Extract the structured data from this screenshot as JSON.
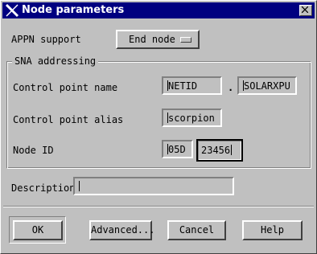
{
  "window": {
    "title": "Node parameters"
  },
  "appn": {
    "label": "APPN support",
    "value": "End node"
  },
  "sna": {
    "group_title": "SNA addressing",
    "cp_name_label": "Control point name",
    "netid": "NETID",
    "dot": ".",
    "cp_name": "SOLARXPU",
    "cp_alias_label": "Control point alias",
    "cp_alias": "scorpion",
    "node_id_label": "Node ID",
    "node_id_block": "05D",
    "node_id_num": "23456"
  },
  "description": {
    "label": "Description",
    "value": ""
  },
  "buttons": {
    "ok": "OK",
    "advanced": "Advanced...",
    "cancel": "Cancel",
    "help": "Help"
  },
  "icons": {
    "title_logo": "x-logo-icon",
    "close": "close-icon"
  }
}
